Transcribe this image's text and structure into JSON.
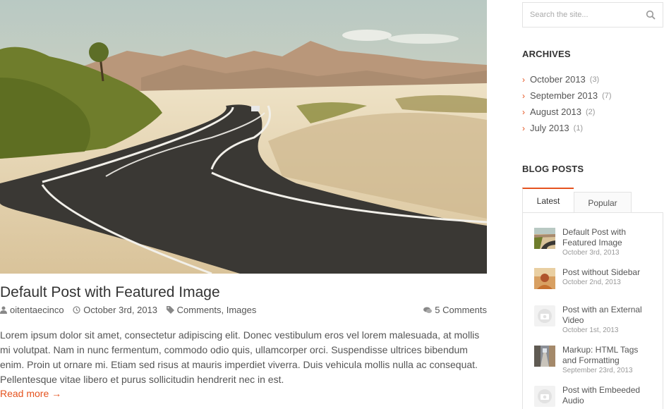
{
  "post": {
    "title": "Default Post with Featured Image",
    "author": "oitentaecinco",
    "date": "October 3rd, 2013",
    "categories": "Comments, Images",
    "comments": "5 Comments",
    "excerpt": "Lorem ipsum dolor sit amet, consectetur adipiscing elit. Donec vestibulum eros vel lorem malesuada, at mollis mi volutpat. Nam in nunc fermentum, commodo odio quis, ullamcorper orci. Suspendisse ultrices bibendum enim. Proin ut ornare mi. Etiam sed risus at mauris imperdiet viverra. Duis vehicula mollis nulla ac consequat. Pellentesque vitae libero et purus sollicitudin hendrerit nec in est.",
    "read_more": "Read more →",
    "image_icon": "desert-road-photo"
  },
  "search": {
    "placeholder": "Search the site..."
  },
  "archives": {
    "title": "ARCHIVES",
    "items": [
      {
        "label": "October 2013",
        "count": "(3)"
      },
      {
        "label": "September 2013",
        "count": "(7)"
      },
      {
        "label": "August 2013",
        "count": "(2)"
      },
      {
        "label": "July 2013",
        "count": "(1)"
      }
    ]
  },
  "blog_posts": {
    "title": "BLOG POSTS",
    "tabs": {
      "latest": "Latest",
      "popular": "Popular"
    },
    "items": [
      {
        "title": "Default Post with Featured Image",
        "date": "October 3rd, 2013",
        "thumb": "road-thumbnail"
      },
      {
        "title": "Post without Sidebar",
        "date": "October 2nd, 2013",
        "thumb": "photo-thumbnail"
      },
      {
        "title": "Post with an External Video",
        "date": "October 1st, 2013",
        "thumb": "placeholder-camera-icon"
      },
      {
        "title": "Markup: HTML Tags and Formatting",
        "date": "September 23rd, 2013",
        "thumb": "street-thumbnail"
      },
      {
        "title": "Post with Embeeded Audio",
        "date": "",
        "thumb": "placeholder-camera-icon"
      }
    ]
  },
  "colors": {
    "accent": "#e5531f",
    "text": "#555555",
    "heading": "#333333",
    "muted": "#999999",
    "border": "#e3e3e3"
  }
}
